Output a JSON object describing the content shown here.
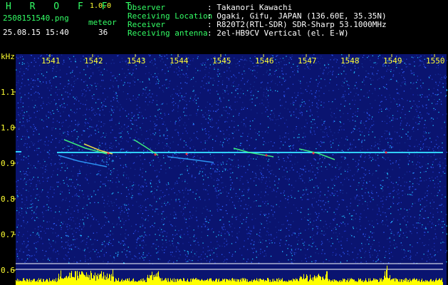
{
  "app": {
    "name": "H R O F F T",
    "version": "1.0.0"
  },
  "file": {
    "name": "2508151540.png",
    "datetime": "25.08.15 15:40"
  },
  "meteor": {
    "label": "meteor",
    "count": "36"
  },
  "station": {
    "rows": [
      {
        "label": "Observer",
        "value": ": Takanori Kawachi"
      },
      {
        "label": "Receiving Location",
        "value": ": Ogaki, Gifu, JAPAN (136.60E, 35.35N)"
      },
      {
        "label": "Receiver",
        "value": ": R820T2(RTL-SDR) SDR-Sharp 53.1000MHz"
      },
      {
        "label": "Receiving antenna",
        "value": ": 2el-HB9CV Vertical (el. E-W)"
      }
    ]
  },
  "axes": {
    "y_unit": "kHz",
    "x_ticks": [
      "1541",
      "1542",
      "1543",
      "1544",
      "1545",
      "1546",
      "1547",
      "1548",
      "1549",
      "1550"
    ],
    "y_ticks": [
      "1.1",
      "1.0",
      "0.9",
      "0.8",
      "0.7",
      "0.6"
    ]
  },
  "colors": {
    "background": "#000000",
    "noise": "#1a2a9a",
    "label_green": "#33ff66",
    "label_yellow": "#ffff33",
    "label_white": "#ffffff",
    "bar_yellow": "#ffff00"
  }
}
